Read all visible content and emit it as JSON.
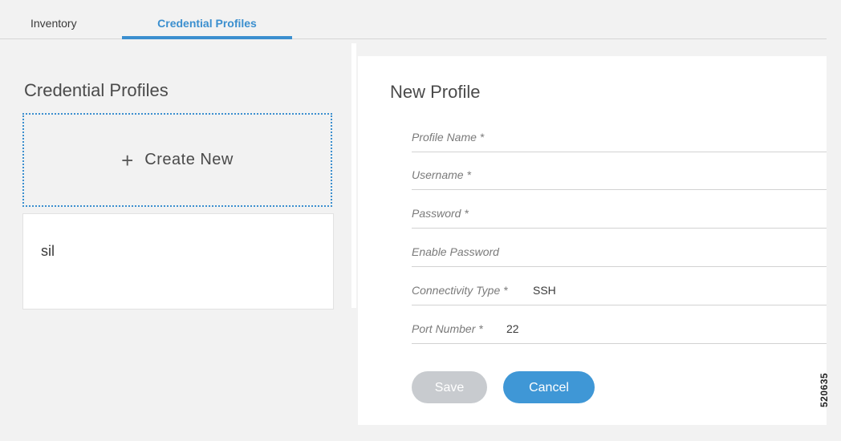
{
  "tabs": [
    {
      "label": "Inventory",
      "active": false
    },
    {
      "label": "Credential Profiles",
      "active": true
    }
  ],
  "left_panel": {
    "title": "Credential Profiles",
    "create_new": {
      "icon": "plus-icon",
      "label": "Create New"
    },
    "profiles": [
      {
        "name": "sil"
      }
    ]
  },
  "form": {
    "title": "New Profile",
    "fields": [
      {
        "label": "Profile Name *",
        "value": ""
      },
      {
        "label": "Username *",
        "value": ""
      },
      {
        "label": "Password *",
        "value": ""
      },
      {
        "label": "Enable Password",
        "value": ""
      },
      {
        "label": "Connectivity Type *",
        "value": "SSH"
      },
      {
        "label": "Port Number *",
        "value": "22"
      }
    ],
    "save_label": "Save",
    "cancel_label": "Cancel"
  },
  "figure_id": "520635",
  "colors": {
    "accent": "#3b8fcf",
    "cancel_button": "#3f97d6",
    "save_button_disabled": "#c8cbcf",
    "background": "#f2f2f2"
  }
}
